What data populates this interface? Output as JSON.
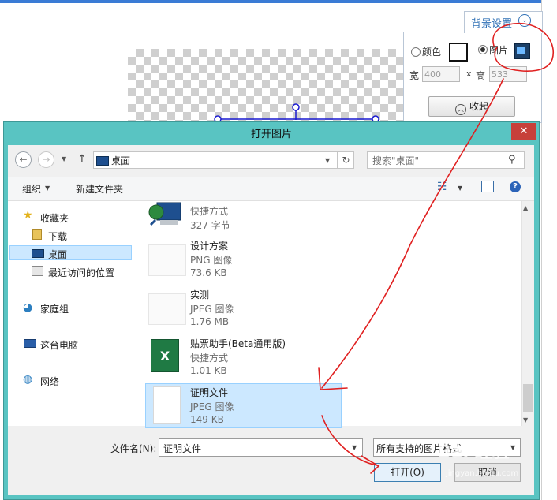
{
  "background_page": {
    "panel_tab_label": "背景设置",
    "color_option": "颜色",
    "image_option": "图片",
    "width_label": "宽",
    "width_value": "400",
    "times_label": "x",
    "height_label": "高",
    "height_value": "533",
    "collapse_label": "收起"
  },
  "dialog": {
    "title": "打开图片",
    "close_glyph": "✕",
    "address": "桌面",
    "search_placeholder": "搜索\"桌面\"",
    "toolbar": {
      "organize_label": "组织",
      "new_folder_label": "新建文件夹"
    },
    "nav": {
      "favorites": "收藏夹",
      "downloads": "下载",
      "desktop": "桌面",
      "recent": "最近访问的位置",
      "homegroup": "家庭组",
      "this_pc": "这台电脑",
      "network": "网络"
    },
    "files": [
      {
        "name": "",
        "type": "快捷方式",
        "size": "327 字节",
        "icon": "network-shortcut-icon"
      },
      {
        "name": "设计方案",
        "type": "PNG 图像",
        "size": "73.6 KB",
        "icon": "image-thumbnail-icon"
      },
      {
        "name": "实测",
        "type": "JPEG 图像",
        "size": "1.76 MB",
        "icon": "image-thumbnail-icon"
      },
      {
        "name": "贴票助手(Beta通用版)",
        "type": "快捷方式",
        "size": "1.01 KB",
        "icon": "excel-icon"
      },
      {
        "name": "证明文件",
        "type": "JPEG 图像",
        "size": "149 KB",
        "icon": "blank-image-icon",
        "selected": true
      }
    ],
    "filename_label": "文件名(N):",
    "filename_value": "证明文件",
    "filetype_value": "所有支持的图片格式",
    "open_label": "打开(O)",
    "cancel_label": "取消"
  },
  "watermark": {
    "text": "Bai 经验",
    "sub": "jingyan.baidu.com"
  },
  "colors": {
    "dialog_frame": "#59c4c2",
    "close_red": "#c7403a",
    "selection": "#cce8ff",
    "annotation_red": "#e02020",
    "link_blue": "#2e6fb5"
  }
}
